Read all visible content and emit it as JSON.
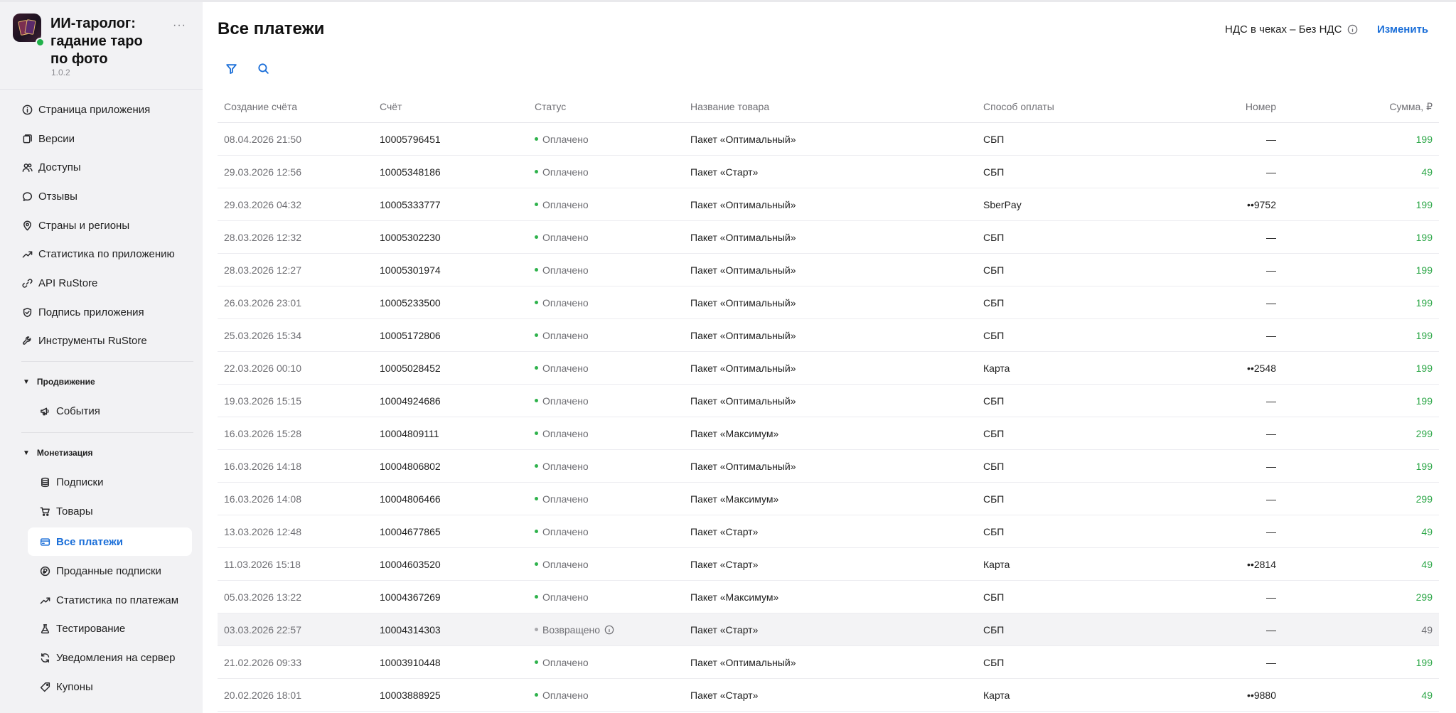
{
  "app": {
    "title": "ИИ-таролог: гадание таро по фото",
    "version": "1.0.2",
    "more": "···"
  },
  "sidebar": {
    "items": [
      {
        "label": "Страница приложения",
        "icon": "info-icon"
      },
      {
        "label": "Версии",
        "icon": "versions-icon"
      },
      {
        "label": "Доступы",
        "icon": "users-icon"
      },
      {
        "label": "Отзывы",
        "icon": "chat-bubble-icon"
      },
      {
        "label": "Страны и регионы",
        "icon": "location-pin-icon"
      },
      {
        "label": "Статистика по приложению",
        "icon": "trend-chart-icon"
      },
      {
        "label": "API RuStore",
        "icon": "link-icon"
      },
      {
        "label": "Подпись приложения",
        "icon": "shield-check-icon"
      },
      {
        "label": "Инструменты RuStore",
        "icon": "tools-icon"
      }
    ],
    "promotion": {
      "title": "Продвижение",
      "items": [
        {
          "label": "События",
          "icon": "megaphone-icon"
        }
      ]
    },
    "monetization": {
      "title": "Монетизация",
      "items": [
        {
          "label": "Подписки",
          "icon": "database-icon"
        },
        {
          "label": "Товары",
          "icon": "cart-icon"
        },
        {
          "label": "Все платежи",
          "icon": "credit-card-icon",
          "active": true
        },
        {
          "label": "Проданные подписки",
          "icon": "coin-icon"
        },
        {
          "label": "Статистика по платежам",
          "icon": "trend-chart-icon"
        },
        {
          "label": "Тестирование",
          "icon": "flask-icon"
        },
        {
          "label": "Уведомления на сервер",
          "icon": "refresh-bell-icon"
        },
        {
          "label": "Купоны",
          "icon": "tag-icon"
        }
      ]
    }
  },
  "header": {
    "title": "Все платежи",
    "vat_label": "НДС в чеках – Без НДС",
    "change_label": "Изменить"
  },
  "colors": {
    "accent": "#1a6ed8",
    "paid_green": "#2fa84a",
    "sidebar_bg": "#f2f2f4"
  },
  "table": {
    "headers": [
      "Создание счёта",
      "Счёт",
      "Статус",
      "Название товара",
      "Способ оплаты",
      "Номер",
      "Сумма, ₽"
    ],
    "rows": [
      {
        "date": "08.04.2026 21:50",
        "invoice": "10005796451",
        "status": "Оплачено",
        "product": "Пакет «Оптимальный»",
        "method": "СБП",
        "number": "—",
        "amount": "199"
      },
      {
        "date": "29.03.2026 12:56",
        "invoice": "10005348186",
        "status": "Оплачено",
        "product": "Пакет «Старт»",
        "method": "СБП",
        "number": "—",
        "amount": "49"
      },
      {
        "date": "29.03.2026 04:32",
        "invoice": "10005333777",
        "status": "Оплачено",
        "product": "Пакет «Оптимальный»",
        "method": "SberPay",
        "number": "••9752",
        "amount": "199"
      },
      {
        "date": "28.03.2026 12:32",
        "invoice": "10005302230",
        "status": "Оплачено",
        "product": "Пакет «Оптимальный»",
        "method": "СБП",
        "number": "—",
        "amount": "199"
      },
      {
        "date": "28.03.2026 12:27",
        "invoice": "10005301974",
        "status": "Оплачено",
        "product": "Пакет «Оптимальный»",
        "method": "СБП",
        "number": "—",
        "amount": "199"
      },
      {
        "date": "26.03.2026 23:01",
        "invoice": "10005233500",
        "status": "Оплачено",
        "product": "Пакет «Оптимальный»",
        "method": "СБП",
        "number": "—",
        "amount": "199"
      },
      {
        "date": "25.03.2026 15:34",
        "invoice": "10005172806",
        "status": "Оплачено",
        "product": "Пакет «Оптимальный»",
        "method": "СБП",
        "number": "—",
        "amount": "199"
      },
      {
        "date": "22.03.2026 00:10",
        "invoice": "10005028452",
        "status": "Оплачено",
        "product": "Пакет «Оптимальный»",
        "method": "Карта",
        "number": "••2548",
        "amount": "199"
      },
      {
        "date": "19.03.2026 15:15",
        "invoice": "10004924686",
        "status": "Оплачено",
        "product": "Пакет «Оптимальный»",
        "method": "СБП",
        "number": "—",
        "amount": "199"
      },
      {
        "date": "16.03.2026 15:28",
        "invoice": "10004809111",
        "status": "Оплачено",
        "product": "Пакет «Максимум»",
        "method": "СБП",
        "number": "—",
        "amount": "299"
      },
      {
        "date": "16.03.2026 14:18",
        "invoice": "10004806802",
        "status": "Оплачено",
        "product": "Пакет «Оптимальный»",
        "method": "СБП",
        "number": "—",
        "amount": "199"
      },
      {
        "date": "16.03.2026 14:08",
        "invoice": "10004806466",
        "status": "Оплачено",
        "product": "Пакет «Максимум»",
        "method": "СБП",
        "number": "—",
        "amount": "299"
      },
      {
        "date": "13.03.2026 12:48",
        "invoice": "10004677865",
        "status": "Оплачено",
        "product": "Пакет «Старт»",
        "method": "СБП",
        "number": "—",
        "amount": "49"
      },
      {
        "date": "11.03.2026 15:18",
        "invoice": "10004603520",
        "status": "Оплачено",
        "product": "Пакет «Старт»",
        "method": "Карта",
        "number": "••2814",
        "amount": "49"
      },
      {
        "date": "05.03.2026 13:22",
        "invoice": "10004367269",
        "status": "Оплачено",
        "product": "Пакет «Максимум»",
        "method": "СБП",
        "number": "—",
        "amount": "299"
      },
      {
        "date": "03.03.2026 22:57",
        "invoice": "10004314303",
        "status": "Возвращено",
        "product": "Пакет «Старт»",
        "method": "СБП",
        "number": "—",
        "amount": "49",
        "refunded": true
      },
      {
        "date": "21.02.2026 09:33",
        "invoice": "10003910448",
        "status": "Оплачено",
        "product": "Пакет «Оптимальный»",
        "method": "СБП",
        "number": "—",
        "amount": "199"
      },
      {
        "date": "20.02.2026 18:01",
        "invoice": "10003888925",
        "status": "Оплачено",
        "product": "Пакет «Старт»",
        "method": "Карта",
        "number": "••9880",
        "amount": "49"
      }
    ]
  }
}
